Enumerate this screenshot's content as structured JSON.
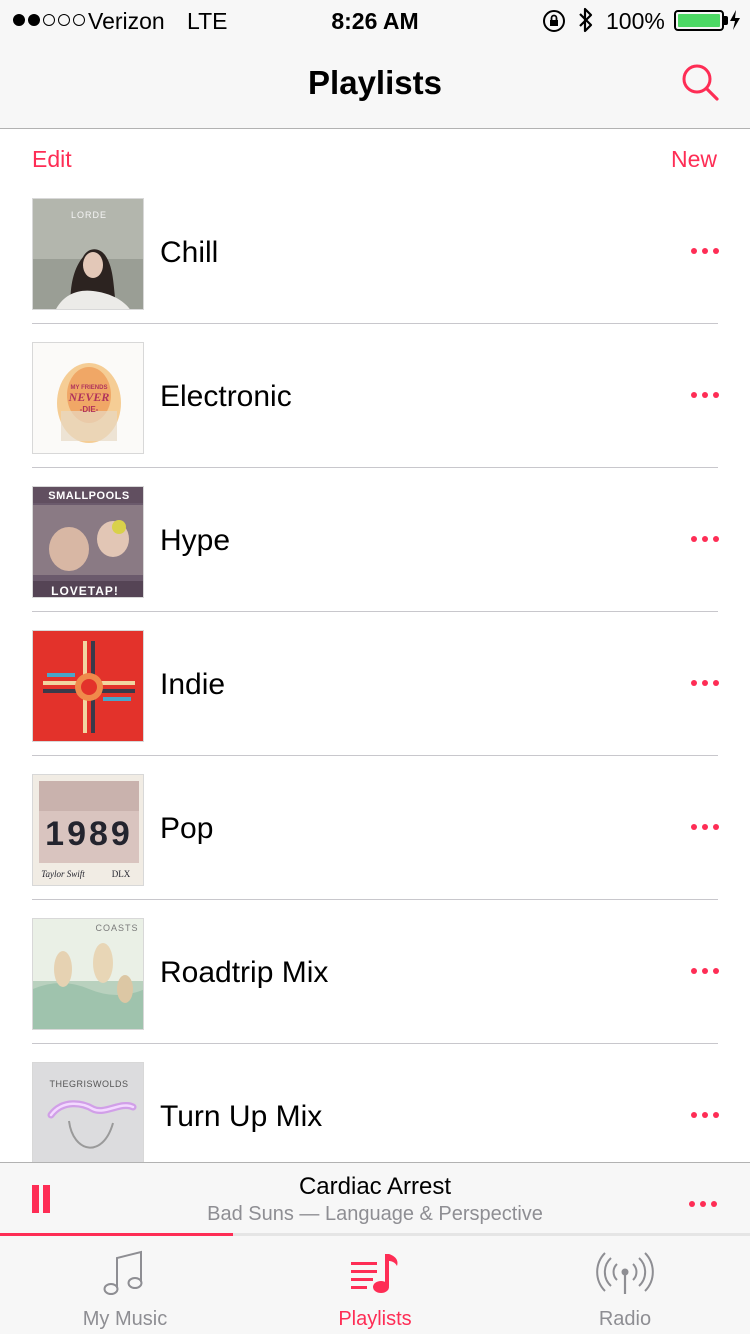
{
  "status_bar": {
    "carrier": "Verizon",
    "network": "LTE",
    "time": "8:26 AM",
    "battery_percent": "100%",
    "signal_bars_filled": 2,
    "signal_bars_total": 5
  },
  "nav": {
    "title": "Playlists",
    "search_icon": "search-icon"
  },
  "actions": {
    "edit_label": "Edit",
    "new_label": "New"
  },
  "colors": {
    "accent": "#fe2d55",
    "battery": "#4cd964",
    "secondary_text": "#8e8e93"
  },
  "playlists": [
    {
      "name": "Chill",
      "art_lettering": "LORDE"
    },
    {
      "name": "Electronic",
      "art_lettering": "MY FRIENDS NEVER DIE"
    },
    {
      "name": "Hype",
      "art_lettering": "SMALLPOOLS LOVETAP!"
    },
    {
      "name": "Indie",
      "art_lettering": ""
    },
    {
      "name": "Pop",
      "art_lettering": "1989 Taylor Swift DLX"
    },
    {
      "name": "Roadtrip Mix",
      "art_lettering": "COASTS"
    },
    {
      "name": "Turn Up Mix",
      "art_lettering": "THEGRISWOLDS"
    }
  ],
  "now_playing": {
    "title": "Cardiac Arrest",
    "subtitle": "Bad Suns — Language & Perspective",
    "progress": 0.31,
    "state": "playing"
  },
  "tabs": [
    {
      "label": "My Music",
      "icon": "music-note-icon",
      "active": false
    },
    {
      "label": "Playlists",
      "icon": "playlists-icon",
      "active": true
    },
    {
      "label": "Radio",
      "icon": "radio-antenna-icon",
      "active": false
    }
  ]
}
